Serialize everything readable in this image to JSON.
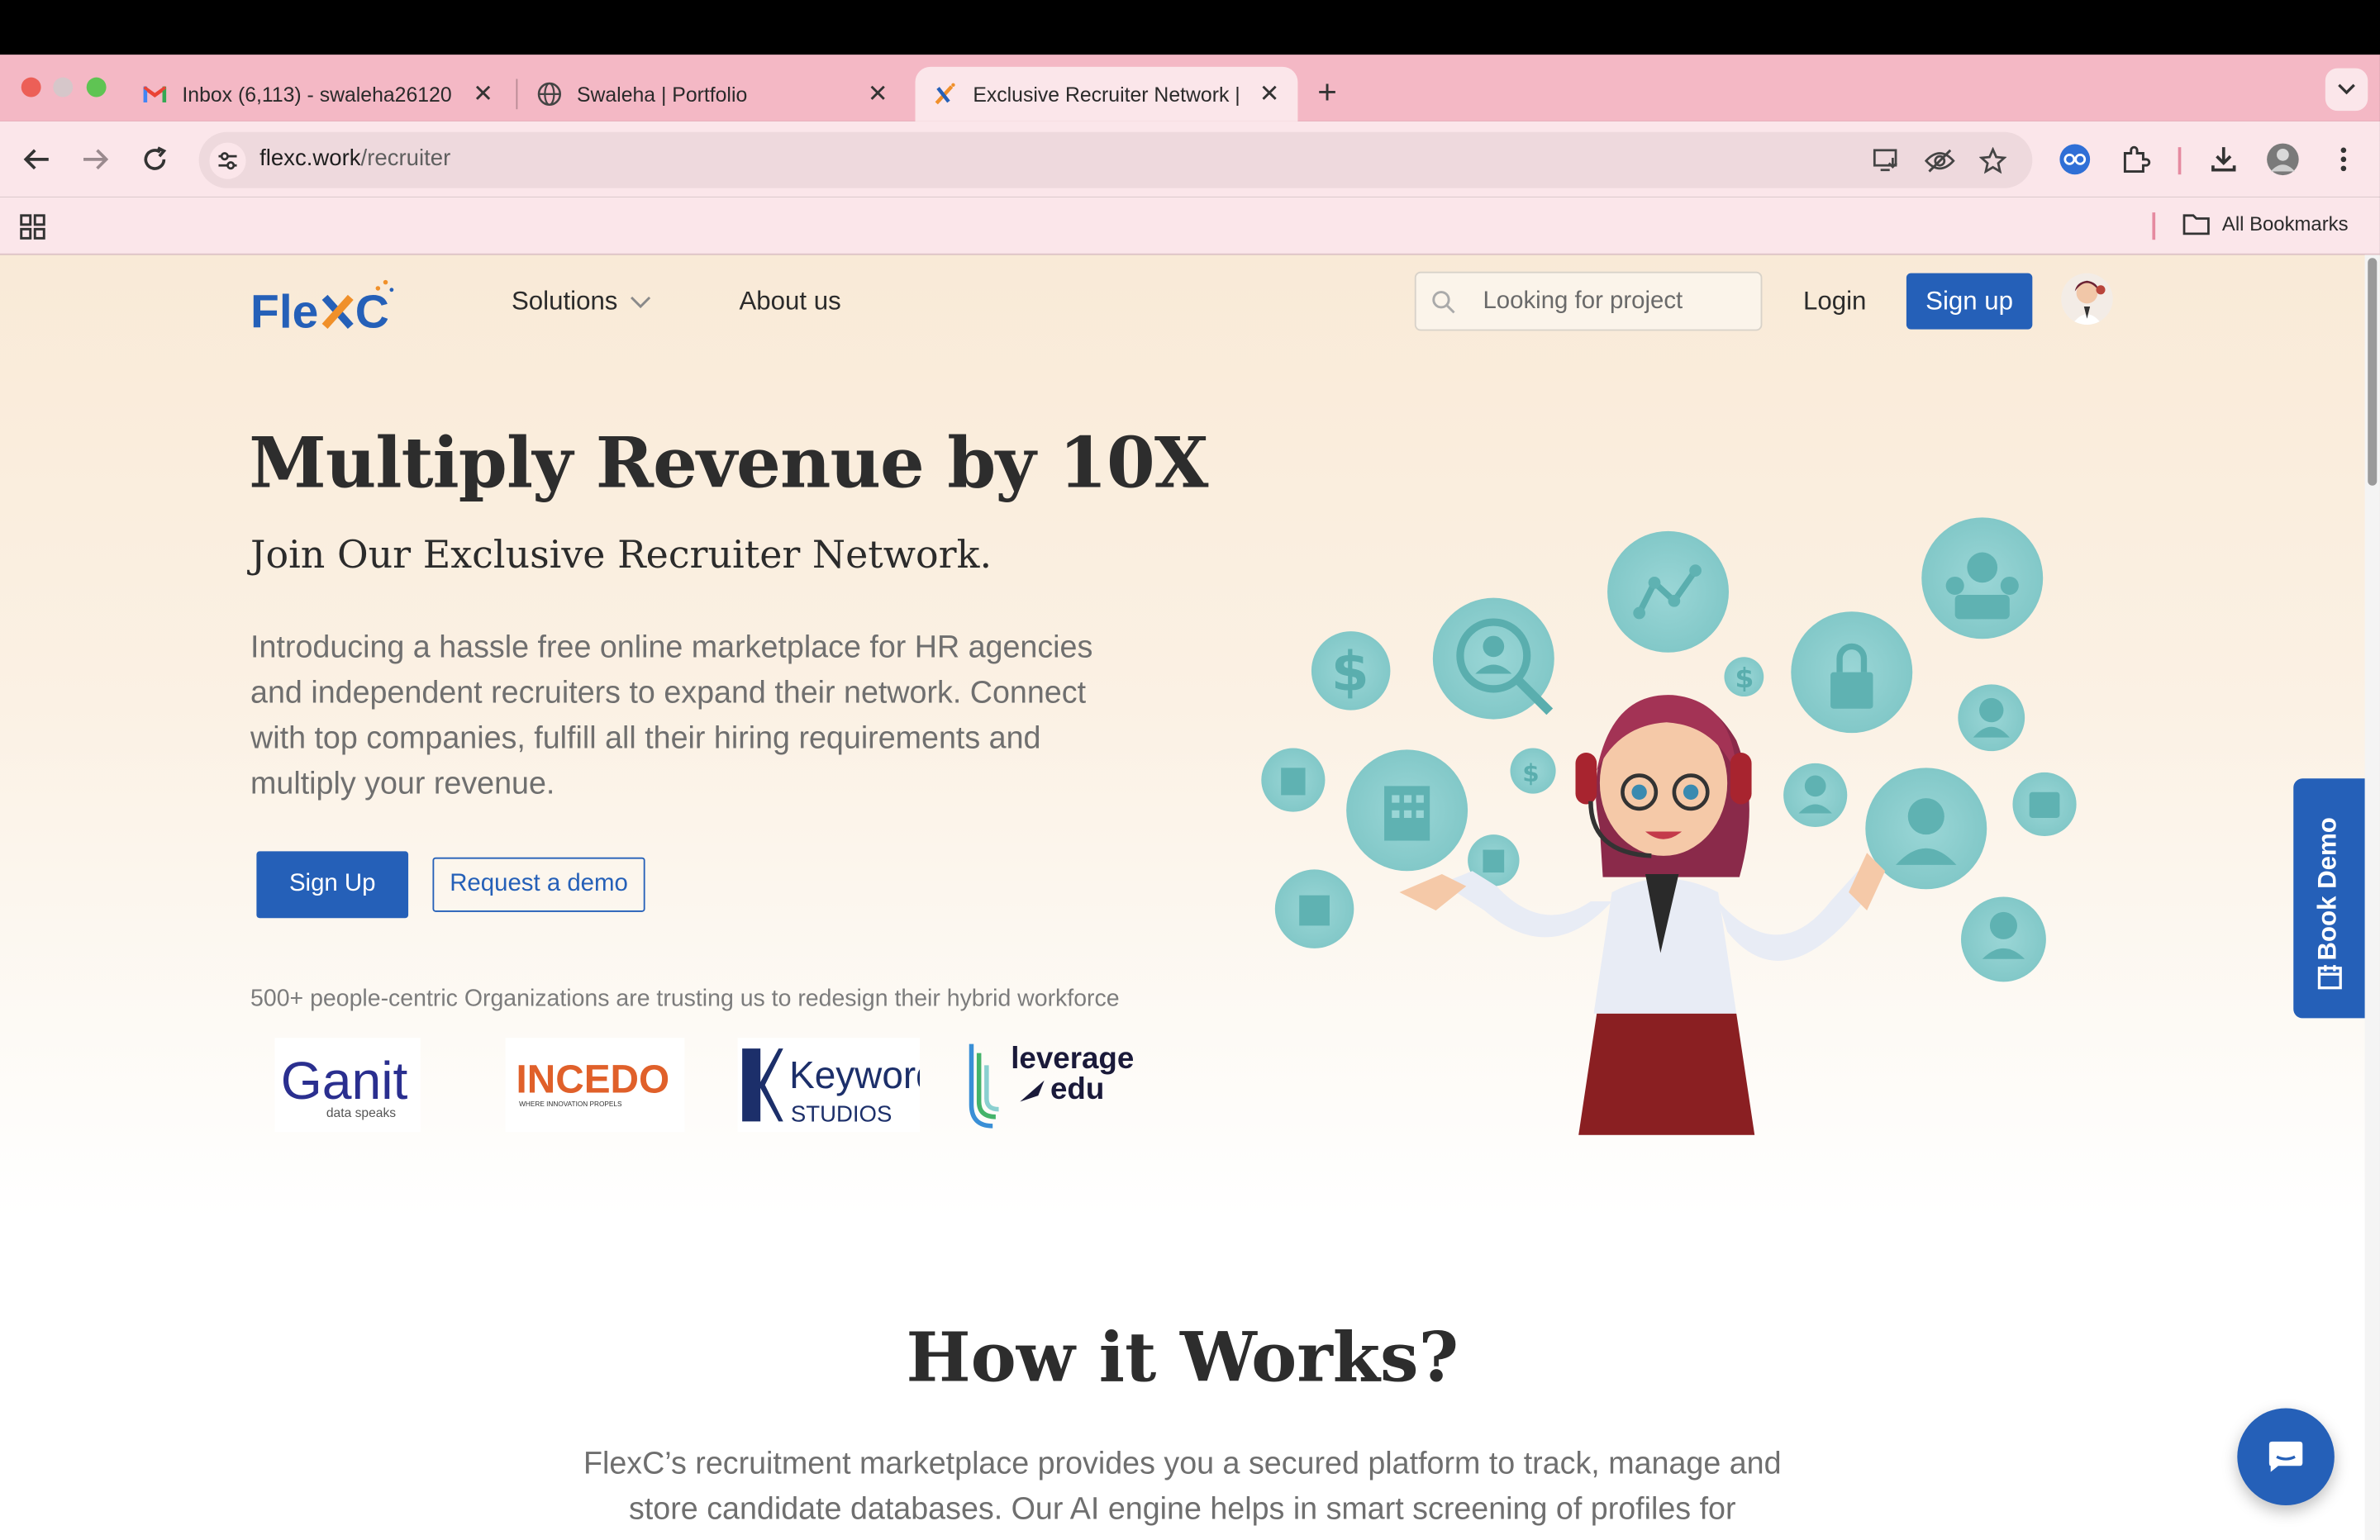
{
  "browser": {
    "tabs": [
      {
        "title": "Inbox (6,113) - swaleha26120",
        "favicon": "gmail-icon"
      },
      {
        "title": "Swaleha | Portfolio",
        "favicon": "globe-icon"
      },
      {
        "title": "Exclusive Recruiter Network |",
        "favicon": "flexc-icon",
        "active": true
      }
    ],
    "url_host": "flexc.work",
    "url_path": "/recruiter",
    "all_bookmarks": "All Bookmarks"
  },
  "nav": {
    "logo_text": "FlexC",
    "solutions": "Solutions",
    "about": "About us",
    "search_placeholder": "Looking for project",
    "login": "Login",
    "signup": "Sign up"
  },
  "hero": {
    "title": "Multiply Revenue by 10X",
    "subtitle": "Join Our Exclusive Recruiter Network.",
    "intro": "Introducing a hassle free online marketplace for HR agencies and independent recruiters to expand their network. Connect with top companies, fulfill all their hiring requirements and multiply your revenue.",
    "signup_btn": "Sign Up",
    "demo_btn": "Request a demo",
    "trust_text": "500+ people-centric Organizations are trusting us to redesign their hybrid workforce",
    "client_logos": [
      {
        "name": "Ganit",
        "tagline": "data speaks"
      },
      {
        "name": "INCEDO",
        "tagline": "WHERE INNOVATION PROPELS"
      },
      {
        "name": "Keywords",
        "tagline": "STUDIOS"
      },
      {
        "name": "leverage",
        "tagline": "edu"
      }
    ]
  },
  "book_demo": "Book Demo",
  "how": {
    "title": "How it Works?",
    "text": "FlexC’s recruitment marketplace provides you a secured platform to track, manage and store candidate databases. Our AI engine helps in smart screening of profiles for"
  },
  "colors": {
    "brand_blue": "#2560b8",
    "brand_orange": "#f0902a",
    "tab_strip": "#f4b8c5",
    "toolbar": "#fbe6ea",
    "bubble": "#8fd0d0"
  }
}
